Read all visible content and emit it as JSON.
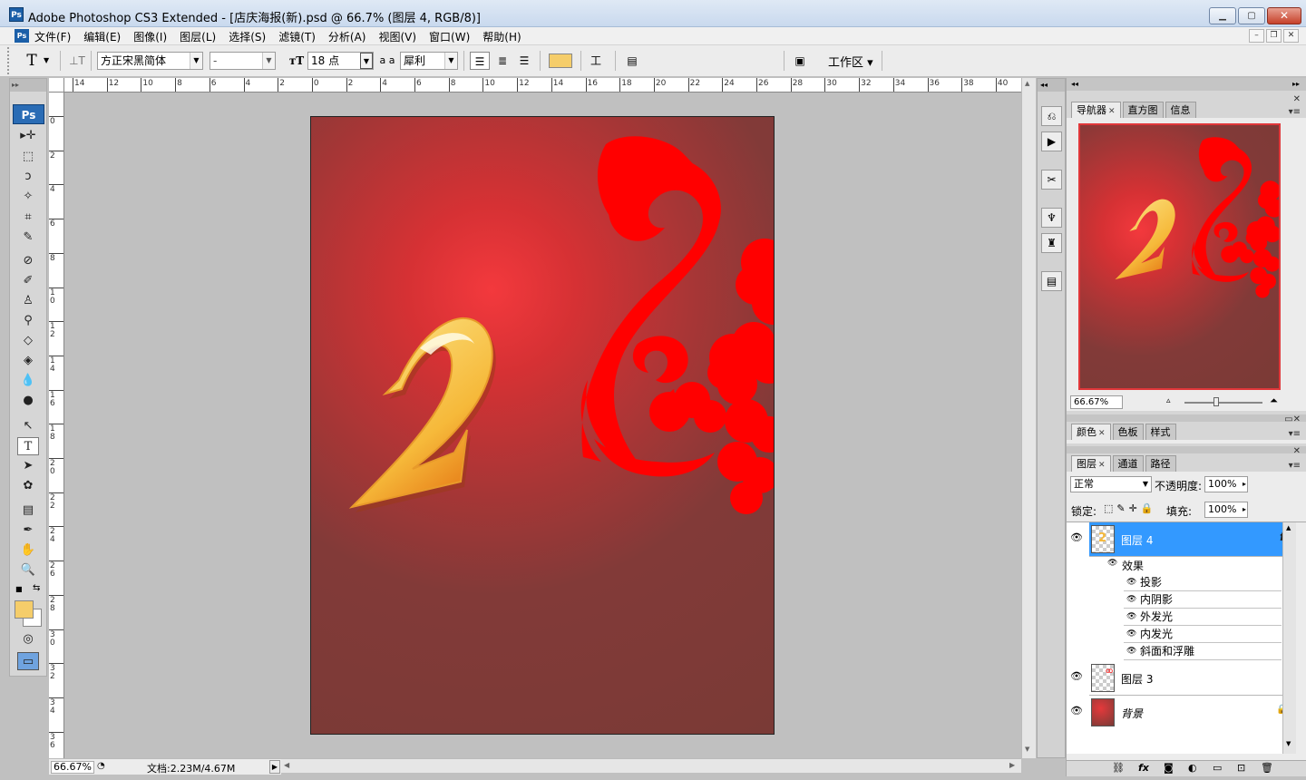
{
  "title_bar": {
    "app_icon": "Ps",
    "title": "Adobe Photoshop CS3 Extended - [店庆海报(新).psd @ 66.7% (图层 4, RGB/8)]"
  },
  "menubar": {
    "items": [
      "文件(F)",
      "编辑(E)",
      "图像(I)",
      "图层(L)",
      "选择(S)",
      "滤镜(T)",
      "分析(A)",
      "视图(V)",
      "窗口(W)",
      "帮助(H)"
    ]
  },
  "options_bar": {
    "tool_glyph": "T",
    "font_family": "方正宋黑简体",
    "font_style": "-",
    "font_size": "18 点",
    "antialias_label": "a a",
    "antialias": "犀利",
    "text_color": "#f5cd6a",
    "workspace_label": "工作区"
  },
  "toolbox": {
    "logo": "Ps",
    "foreground_color": "#f5cd6a",
    "background_color": "#ffffff"
  },
  "rulers": {
    "horizontal": [
      "14",
      "12",
      "10",
      "8",
      "6",
      "4",
      "2",
      "0",
      "2",
      "4",
      "6",
      "8",
      "10",
      "12",
      "14",
      "16",
      "18",
      "20",
      "22",
      "24",
      "26",
      "28",
      "30",
      "32",
      "34",
      "36",
      "38",
      "40"
    ],
    "vertical": [
      "0",
      "2",
      "4",
      "6",
      "8",
      "1 0",
      "1 2",
      "1 4",
      "1 6",
      "1 8",
      "2 0",
      "2 2",
      "2 4",
      "2 6",
      "2 8",
      "3 0",
      "3 2",
      "3 4",
      "3 6"
    ]
  },
  "canvas": {
    "background_gradient": [
      "#f3393d",
      "#7a3a36"
    ],
    "numeral": "2",
    "numeral_colors": [
      "#fff1b5",
      "#f6b93a",
      "#e8831b"
    ],
    "ornament_color": "#ff0000"
  },
  "navigator": {
    "tabs": [
      "导航器",
      "直方图",
      "信息"
    ],
    "zoom": "66.67%",
    "proxy_color": "#e0373a"
  },
  "color_panel": {
    "tabs": [
      "颜色",
      "色板",
      "样式"
    ]
  },
  "layers_panel": {
    "tabs": [
      "图层",
      "通道",
      "路径"
    ],
    "blend_mode": "正常",
    "opacity_label": "不透明度:",
    "opacity": "100%",
    "lock_label": "锁定:",
    "fill_label": "填充:",
    "fill": "100%",
    "layers": [
      {
        "name": "图层 4",
        "fx": "fx",
        "selected": true
      },
      {
        "name": "图层 3"
      },
      {
        "name": "背景",
        "locked": true
      }
    ],
    "effects_label": "效果",
    "effects": [
      "投影",
      "内阴影",
      "外发光",
      "内发光",
      "斜面和浮雕"
    ],
    "selection_color": "#3399ff"
  },
  "status_bar": {
    "zoom": "66.67%",
    "doc_info": "文档:2.23M/4.67M"
  }
}
